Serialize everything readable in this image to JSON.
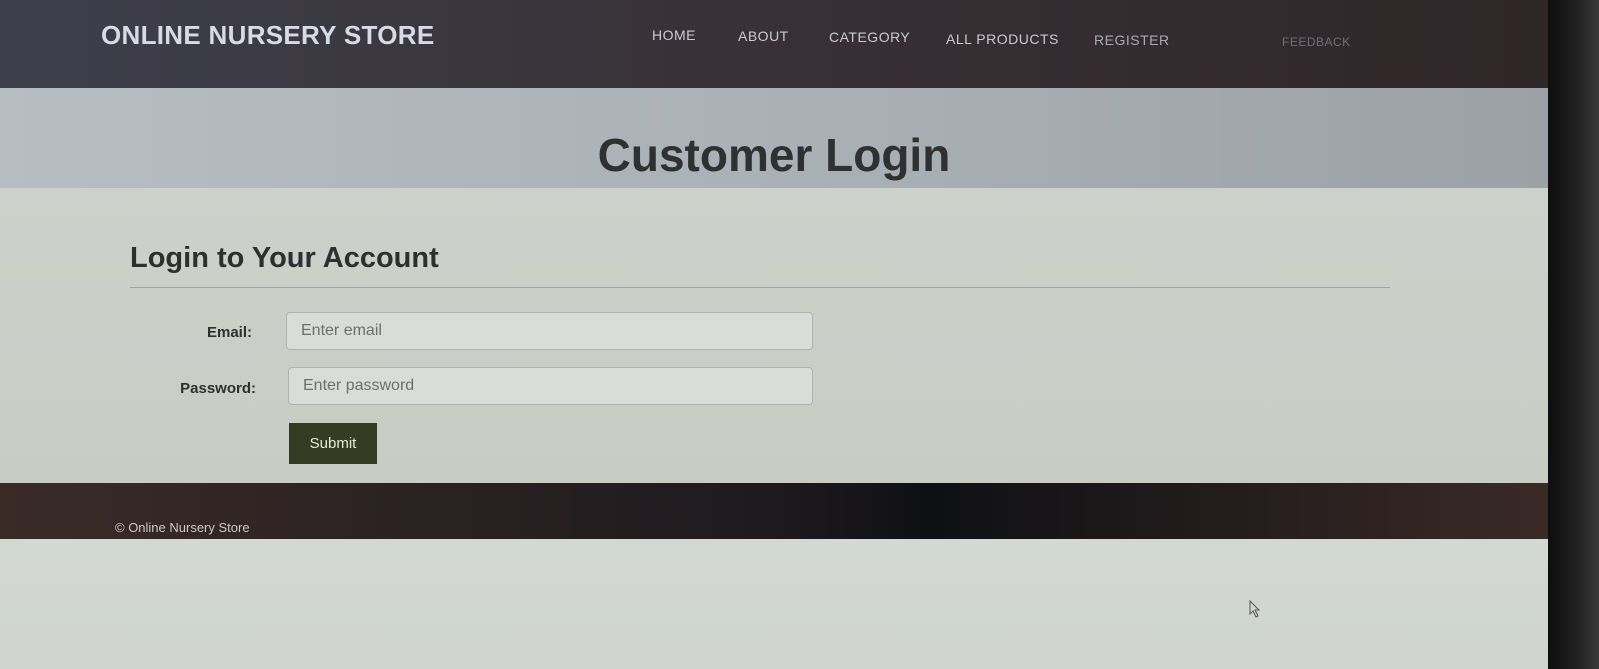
{
  "brand": "ONLINE NURSERY STORE",
  "nav": {
    "items": [
      {
        "label": "HOME"
      },
      {
        "label": "ABOUT"
      },
      {
        "label": "CATEGORY"
      },
      {
        "label": "ALL PRODUCTS"
      },
      {
        "label": "REGISTER"
      },
      {
        "label": "FEEDBACK"
      }
    ]
  },
  "hero": {
    "title": "Customer Login"
  },
  "form": {
    "section_title": "Login to Your Account",
    "email_label": "Email:",
    "email_placeholder": "Enter email",
    "email_value": "",
    "password_label": "Password:",
    "password_placeholder": "Enter password",
    "password_value": "",
    "submit_label": "Submit"
  },
  "footer": {
    "text": "© Online Nursery Store"
  },
  "colors": {
    "navbar": "#3a3340",
    "submit_button": "#343c22",
    "footer": "#2a201e"
  },
  "icons": {
    "cursor": "mouse-pointer-icon"
  }
}
